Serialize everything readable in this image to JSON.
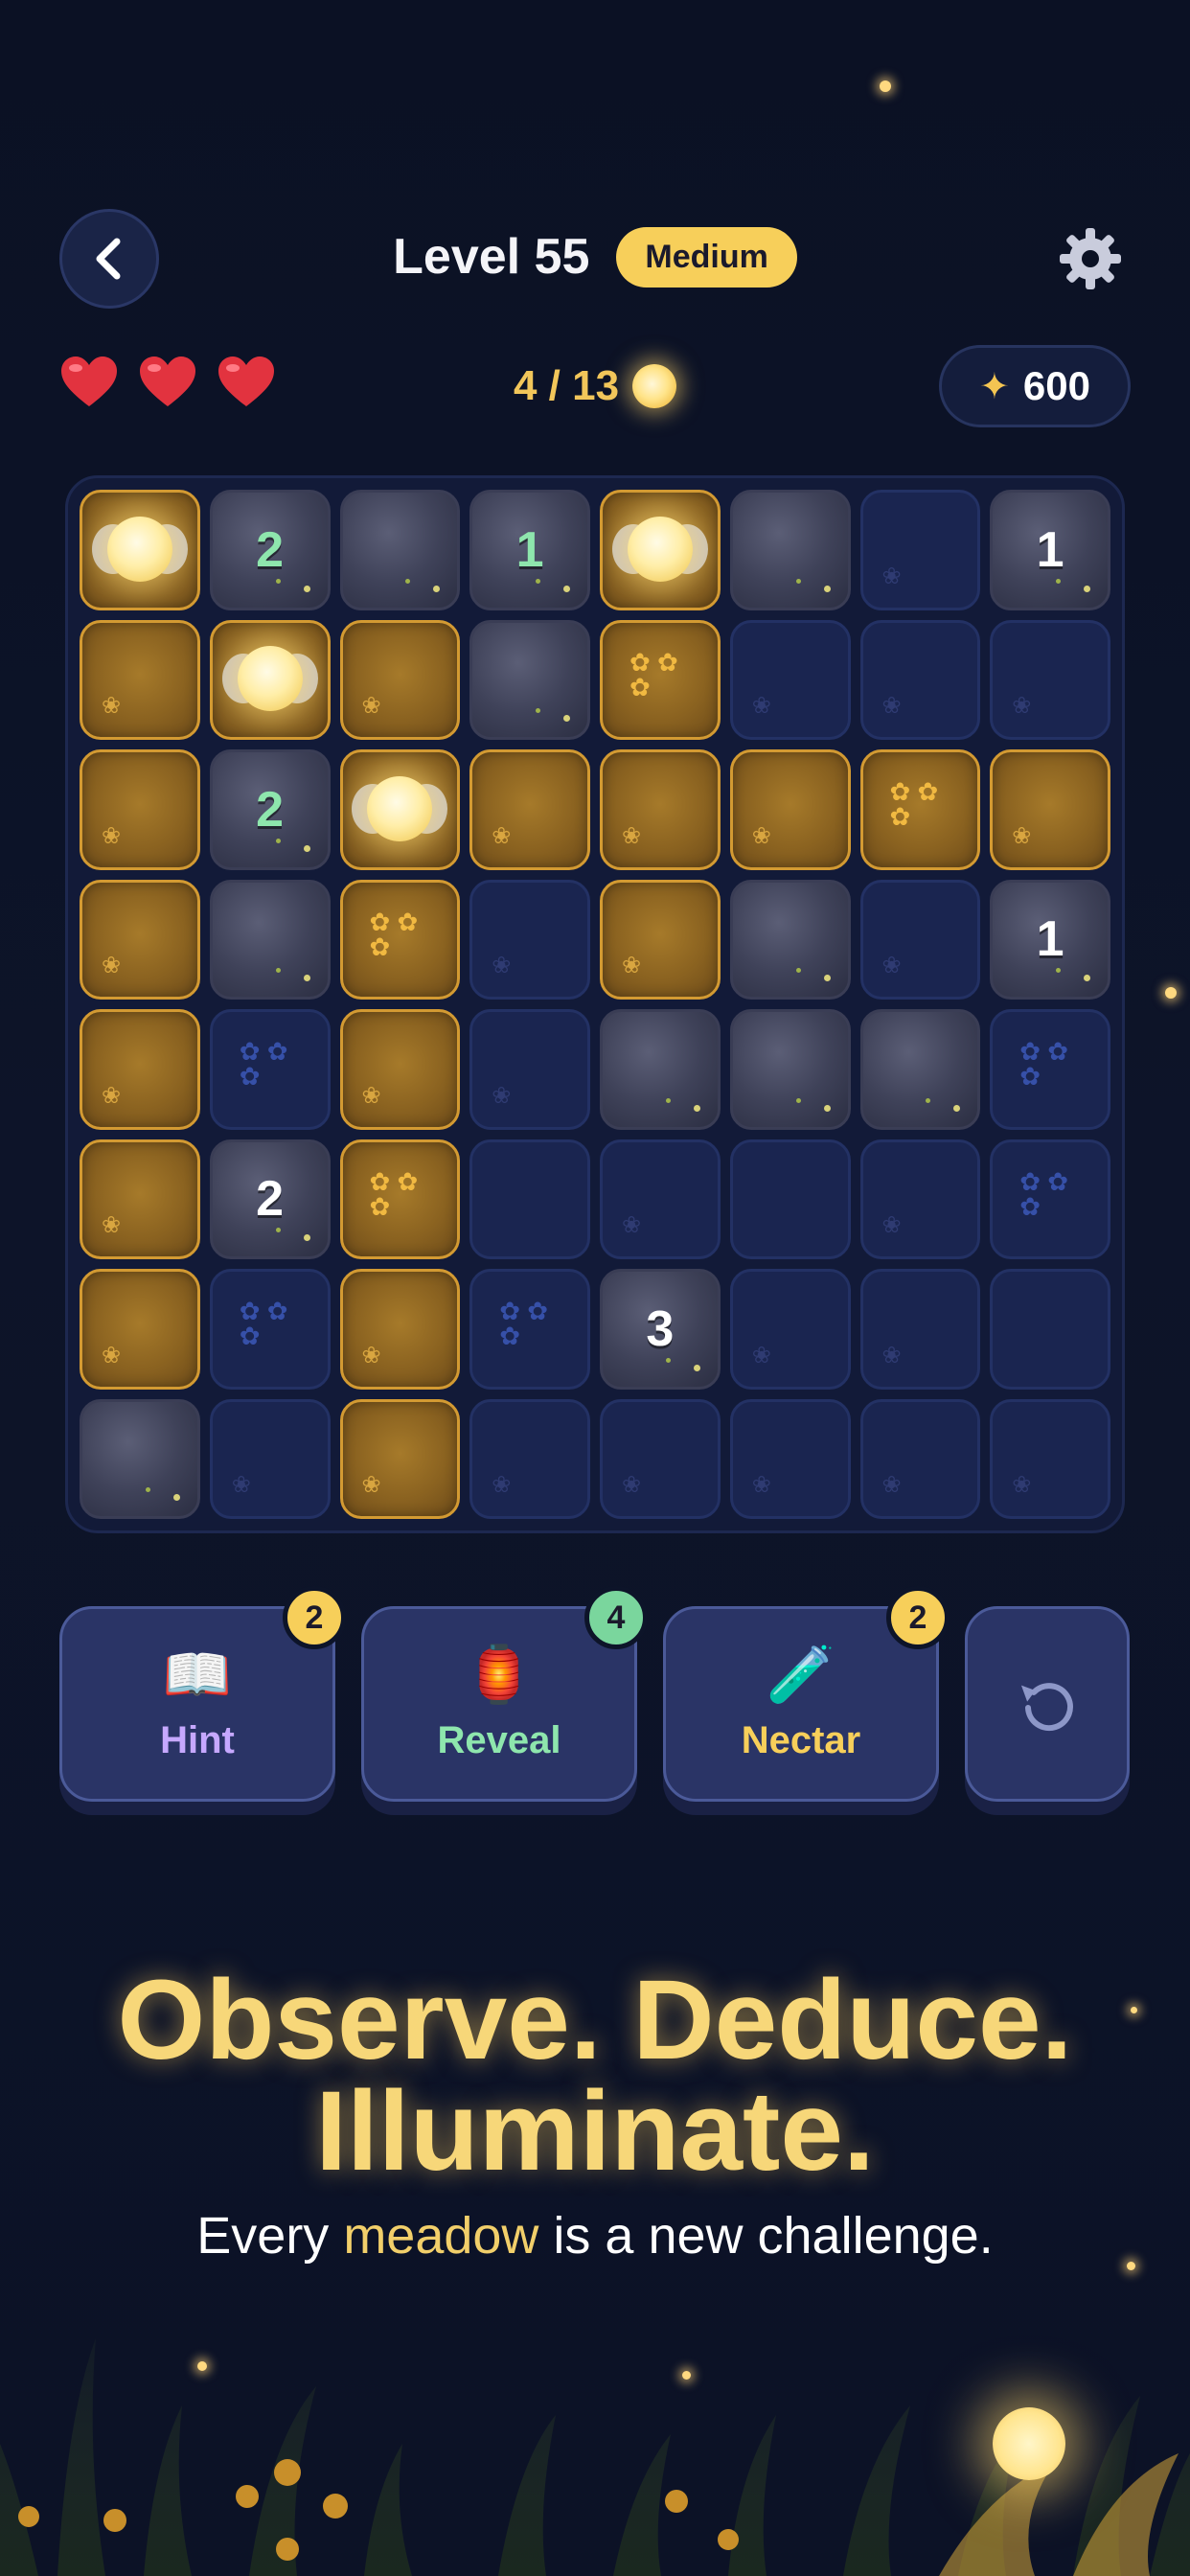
{
  "header": {
    "back_icon": "chevron-left-icon",
    "level_title": "Level 55",
    "difficulty": "Medium",
    "settings_icon": "gear-icon"
  },
  "status": {
    "lives": 3,
    "progress": "4 / 13",
    "score": "600",
    "colors": {
      "heart": "#e2333f",
      "gold": "#f2c65a"
    }
  },
  "board": {
    "rows": 8,
    "cols": 8,
    "cells": [
      [
        {
          "t": "dirt",
          "f": true
        },
        {
          "t": "rock",
          "n": "2",
          "c": "green"
        },
        {
          "t": "rock"
        },
        {
          "t": "rock",
          "n": "1",
          "c": "green"
        },
        {
          "t": "dirt",
          "f": true
        },
        {
          "t": "rock"
        },
        {
          "t": "empty",
          "d": "sprout"
        },
        {
          "t": "rock",
          "n": "1",
          "c": "white"
        }
      ],
      [
        {
          "t": "dirt",
          "d": "sprout"
        },
        {
          "t": "dirt",
          "f": true
        },
        {
          "t": "dirt",
          "d": "sprout"
        },
        {
          "t": "rock"
        },
        {
          "t": "dirt",
          "d": "flowers"
        },
        {
          "t": "empty",
          "d": "sprout"
        },
        {
          "t": "empty",
          "d": "sprout"
        },
        {
          "t": "empty",
          "d": "sprout"
        }
      ],
      [
        {
          "t": "dirt",
          "d": "sprout"
        },
        {
          "t": "rock",
          "n": "2",
          "c": "green"
        },
        {
          "t": "dirt",
          "f": true
        },
        {
          "t": "dirt",
          "d": "sprout"
        },
        {
          "t": "dirt",
          "d": "sprout"
        },
        {
          "t": "dirt",
          "d": "sprout"
        },
        {
          "t": "dirt",
          "d": "flowers"
        },
        {
          "t": "dirt",
          "d": "sprout"
        }
      ],
      [
        {
          "t": "dirt",
          "d": "sprout"
        },
        {
          "t": "rock"
        },
        {
          "t": "dirt",
          "d": "flowers"
        },
        {
          "t": "empty",
          "d": "sprout"
        },
        {
          "t": "dirt",
          "d": "sprout"
        },
        {
          "t": "rock"
        },
        {
          "t": "empty",
          "d": "sprout"
        },
        {
          "t": "rock",
          "n": "1",
          "c": "white"
        }
      ],
      [
        {
          "t": "dirt",
          "d": "sprout"
        },
        {
          "t": "empty",
          "d": "flowers"
        },
        {
          "t": "dirt",
          "d": "sprout"
        },
        {
          "t": "empty",
          "d": "sprout"
        },
        {
          "t": "rock"
        },
        {
          "t": "rock"
        },
        {
          "t": "rock"
        },
        {
          "t": "empty",
          "d": "flowers"
        }
      ],
      [
        {
          "t": "dirt",
          "d": "sprout"
        },
        {
          "t": "rock",
          "n": "2",
          "c": "white"
        },
        {
          "t": "dirt",
          "d": "flowers"
        },
        {
          "t": "empty"
        },
        {
          "t": "empty",
          "d": "sprout"
        },
        {
          "t": "empty"
        },
        {
          "t": "empty",
          "d": "sprout"
        },
        {
          "t": "empty",
          "d": "flowers"
        }
      ],
      [
        {
          "t": "dirt",
          "d": "sprout"
        },
        {
          "t": "empty",
          "d": "flowers"
        },
        {
          "t": "dirt",
          "d": "sprout"
        },
        {
          "t": "empty",
          "d": "flowers"
        },
        {
          "t": "rock",
          "n": "3",
          "c": "white"
        },
        {
          "t": "empty",
          "d": "sprout"
        },
        {
          "t": "empty",
          "d": "sprout"
        },
        {
          "t": "empty"
        }
      ],
      [
        {
          "t": "rock"
        },
        {
          "t": "empty",
          "d": "sprout"
        },
        {
          "t": "dirt",
          "d": "sprout"
        },
        {
          "t": "empty",
          "d": "sprout"
        },
        {
          "t": "empty",
          "d": "sprout"
        },
        {
          "t": "empty",
          "d": "sprout"
        },
        {
          "t": "empty",
          "d": "sprout"
        },
        {
          "t": "empty",
          "d": "sprout"
        }
      ]
    ]
  },
  "powerups": [
    {
      "label": "Hint",
      "count": "2",
      "icon": "open-book-icon",
      "glyph": "📖",
      "label_color": "#c6a8ff",
      "badge_color": "#f7cf5a"
    },
    {
      "label": "Reveal",
      "count": "4",
      "icon": "lantern-icon",
      "glyph": "🏮",
      "label_color": "#8ee6ad",
      "badge_color": "#7ad69d"
    },
    {
      "label": "Nectar",
      "count": "2",
      "icon": "potion-icon",
      "glyph": "🧪",
      "label_color": "#f7cf5a",
      "badge_color": "#f7cf5a"
    }
  ],
  "undo_icon": "undo-icon",
  "tagline": {
    "line1": "Observe. Deduce.",
    "line2": "Illuminate.",
    "sub_before": "Every ",
    "sub_accent": "meadow",
    "sub_after": " is a new challenge."
  }
}
